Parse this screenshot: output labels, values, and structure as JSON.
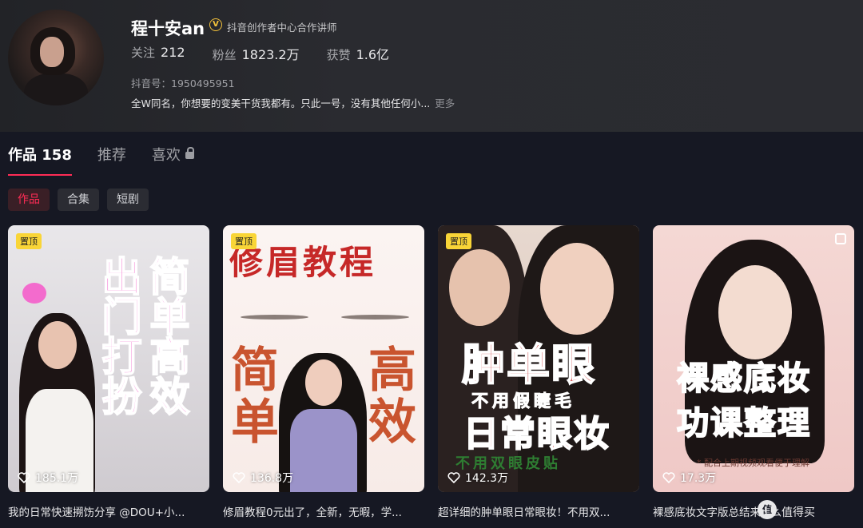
{
  "profile": {
    "name": "程十安an",
    "verify_badge": "V",
    "verify_text": "抖音创作者中心合作讲师",
    "stats": [
      {
        "label": "关注",
        "value": "212"
      },
      {
        "label": "粉丝",
        "value": "1823.2万"
      },
      {
        "label": "获赞",
        "value": "1.6亿"
      }
    ],
    "douyin_id": "抖音号：1950495951",
    "bio": "全W同名，你想要的变美干货我都有。只此一号，没有其他任何小...",
    "bio_more": "更多"
  },
  "tabs": [
    {
      "label": "作品",
      "count": "158"
    },
    {
      "label": "推荐"
    },
    {
      "label": "喜欢"
    }
  ],
  "subtabs": [
    "作品",
    "合集",
    "短剧"
  ],
  "videos": [
    {
      "pin": "置顶",
      "likes": "185.1万",
      "caption": "我的日常快速搠饬分享 @DOU+小...",
      "cover_text": [
        "出门打扮",
        "简单高效"
      ]
    },
    {
      "pin": "置顶",
      "likes": "136.8万",
      "caption": "修眉教程0元出了，全新，无暇，学...",
      "cover_text": [
        "修眉教程",
        "简单",
        "高效"
      ]
    },
    {
      "pin": "置顶",
      "likes": "142.3万",
      "caption": "超详细的肿单眼日常眼妆！不用双...",
      "cover_text": [
        "肿单眼",
        "不用假睫毛",
        "日常眼妆",
        "不用双眼皮贴"
      ]
    },
    {
      "pin": "",
      "likes": "17.3万",
      "caption": "裸感底妆文字版总结来了！",
      "cover_text": [
        "裸感底妆",
        "功课整理",
        "* 配合上期视频观看便于理解"
      ]
    }
  ],
  "watermark": {
    "icon_text": "值",
    "text": "什么值得买"
  },
  "colors": {
    "accent": "#fe2c55",
    "pin_bg": "#f9d537",
    "verify": "#f5c33b"
  }
}
